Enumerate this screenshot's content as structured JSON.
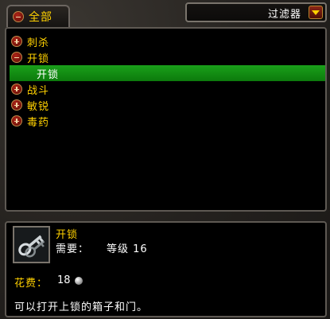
{
  "header": {
    "tab_all_label": "全部",
    "filter_label": "过滤器"
  },
  "list": {
    "items": [
      {
        "label": "刺杀",
        "state": "collapsed"
      },
      {
        "label": "开锁",
        "state": "expanded"
      },
      {
        "label": "开锁",
        "state": "child-selected"
      },
      {
        "label": "战斗",
        "state": "collapsed"
      },
      {
        "label": "敏锐",
        "state": "collapsed"
      },
      {
        "label": "毒药",
        "state": "collapsed"
      }
    ]
  },
  "detail": {
    "icon": "lockpick-key-icon",
    "name": "开锁",
    "requirement_label": "需要：",
    "requirement_value": "等级 16",
    "cost_label": "花费：",
    "cost_value": "18",
    "cost_currency_icon": "silver-coin-icon",
    "description": "可以打开上锁的箱子和门。"
  },
  "colors": {
    "gold_text": "#ffd100",
    "selected_row": "#1aa01a",
    "white_text": "#ffffff"
  }
}
